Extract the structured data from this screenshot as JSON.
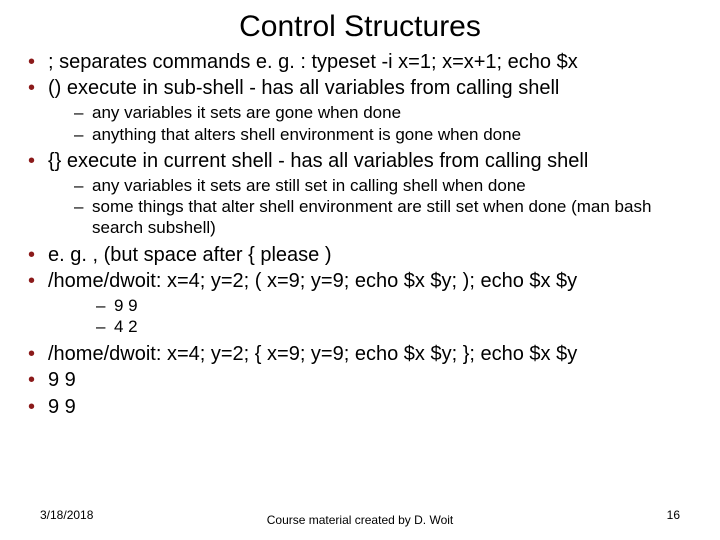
{
  "title": "Control Structures",
  "b1": ";  separates commands  e. g. : typeset -i x=1; x=x+1; echo $x",
  "b2": "() execute in sub-shell  - has all variables from calling shell",
  "b2s1": "any variables it sets are gone when done",
  "b2s2": "anything that alters shell environment is gone when done",
  "b3": "{} execute in current shell - has all variables from calling shell",
  "b3s1": "any variables it sets are still set in calling shell when done",
  "b3s2": "some things that alter shell environment are still set when done (man bash search subshell)",
  "b4": "e. g. , (but space after { please )",
  "b5": "/home/dwoit: x=4; y=2; ( x=9; y=9; echo $x $y; ); echo $x $y",
  "b5s1": "9 9",
  "b5s2": "4 2",
  "b6": "/home/dwoit: x=4; y=2; { x=9; y=9; echo $x $y; }; echo $x $y",
  "b7": "9 9",
  "b8": "9 9",
  "footer_date": "3/18/2018",
  "footer_mid": "Course material created by D. Woit",
  "footer_page": "16"
}
